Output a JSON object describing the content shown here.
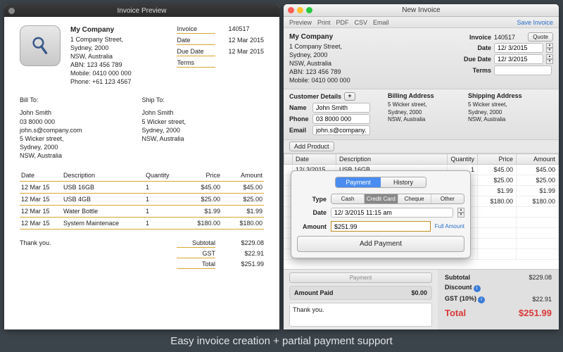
{
  "caption": "Easy invoice creation + partial payment support",
  "preview_window": {
    "title": "Invoice Preview"
  },
  "editor_window": {
    "title": "New Invoice",
    "save": "Save Invoice",
    "toolbar": [
      "Preview",
      "Print",
      "PDF",
      "CSV",
      "Email"
    ]
  },
  "company": {
    "name": "My Company",
    "lines": [
      "1 Company Street,",
      "Sydney, 2000",
      "NSW, Australia",
      "ABN: 123 456 789",
      "Mobile: 0410 000 000",
      "Phone: +61 123 4567"
    ]
  },
  "inv": {
    "labels": {
      "invoice": "Invoice",
      "date": "Date",
      "due": "Due Date",
      "terms": "Terms"
    },
    "number": "140517",
    "date": "12 Mar 2015",
    "due": "12 Mar 2015",
    "terms": ""
  },
  "billto_label": "Bill To:",
  "shipto_label": "Ship To:",
  "billto": [
    "John Smith",
    "03 8000 000",
    "john.s@company.com",
    "5 Wicker street,",
    "Sydney, 2000",
    "NSW, Australia"
  ],
  "shipto": [
    "John Smith",
    "5 Wicker street,",
    "Sydney, 2000",
    "NSW, Australia"
  ],
  "item_headers": [
    "Date",
    "Description",
    "Quantity",
    "Price",
    "Amount"
  ],
  "items": [
    {
      "date": "12 Mar 15",
      "desc": "USB 16GB",
      "qty": "1",
      "price": "$45.00",
      "amt": "$45.00"
    },
    {
      "date": "12 Mar 15",
      "desc": "USB 4GB",
      "qty": "1",
      "price": "$25.00",
      "amt": "$25.00"
    },
    {
      "date": "12 Mar 15",
      "desc": "Water Bottle",
      "qty": "1",
      "price": "$1.99",
      "amt": "$1.99"
    },
    {
      "date": "12 Mar 15",
      "desc": "System Maintenace",
      "qty": "1",
      "price": "$180.00",
      "amt": "$180.00"
    }
  ],
  "thanks": "Thank you.",
  "totals": {
    "subtotal_k": "Subtotal",
    "subtotal": "$229.08",
    "gst_k": "GST",
    "gst": "$22.91",
    "total_k": "Total",
    "total": "$251.99"
  },
  "editor": {
    "meta": {
      "invoice": "140517",
      "date": "12/ 3/2015",
      "due": "12/ 3/2015",
      "terms": "",
      "quote": "Quote"
    },
    "cust": {
      "hdr": "Customer Details",
      "name_k": "Name",
      "name": "John Smith",
      "phone_k": "Phone",
      "phone": "03 8000 000",
      "email_k": "Email",
      "email": "john.s@company.com"
    },
    "bill": {
      "hdr": "Billing Address",
      "txt": "5 Wicker street,\nSydney, 2000\nNSW, Australia"
    },
    "ship": {
      "hdr": "Shipping Address",
      "txt": "5 Wicker street,\nSydney, 2000\nNSW, Australia"
    },
    "add_product": "Add Product",
    "grid_headers": [
      "",
      "Date",
      "Description",
      "Quantity",
      "Price",
      "Amount"
    ],
    "grid": [
      {
        "date": "12/ 3/2015",
        "desc": "USB 16GB",
        "qty": "1",
        "price": "$45.00",
        "amt": "$45.00"
      },
      {
        "date": "",
        "desc": "",
        "qty": "",
        "price": "$25.00",
        "amt": "$25.00"
      },
      {
        "date": "",
        "desc": "",
        "qty": "",
        "price": "$1.99",
        "amt": "$1.99"
      },
      {
        "date": "",
        "desc": "",
        "qty": "",
        "price": "$180.00",
        "amt": "$180.00"
      }
    ],
    "payment_tab": "Payment",
    "amount_paid_k": "Amount Paid",
    "amount_paid": "$0.00",
    "note": "Thank you.",
    "summary": {
      "subtotal_k": "Subtotal",
      "subtotal": "$229.08",
      "discount_k": "Discount",
      "gst_k": "GST (10%)",
      "gst": "$22.91",
      "total_k": "Total",
      "total": "$251.99"
    }
  },
  "popover": {
    "tabs": [
      "Payment",
      "History"
    ],
    "type_k": "Type",
    "types": [
      "Cash",
      "Credit Card",
      "Cheque",
      "Other"
    ],
    "date_k": "Date",
    "date": "12/ 3/2015 11:15 am",
    "amount_k": "Amount",
    "amount": "$251.99",
    "full": "Full Amount",
    "add": "Add Payment"
  }
}
